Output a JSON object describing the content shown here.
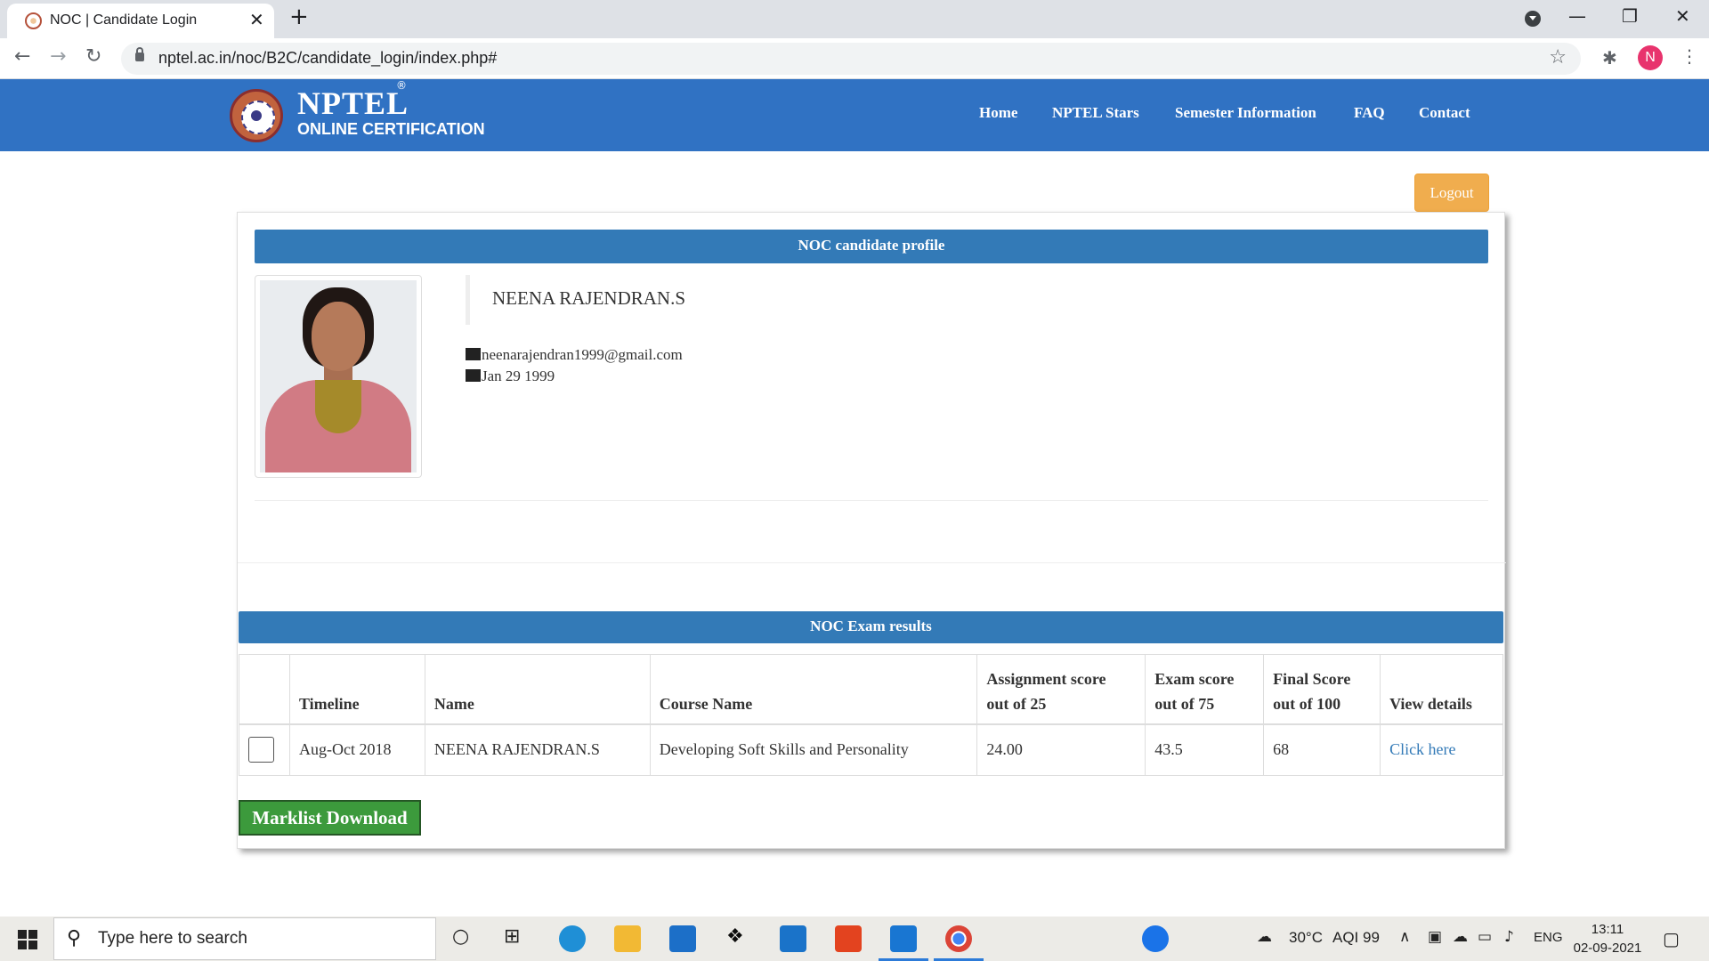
{
  "browser": {
    "tab_title": "NOC | Candidate Login",
    "tab_close": "✕",
    "new_tab": "+",
    "url": "nptel.ac.in/noc/B2C/candidate_login/index.php#",
    "profile_initial": "N",
    "window_controls": [
      "—",
      "❐",
      "✕"
    ]
  },
  "site": {
    "logo_title": "NPTEL",
    "logo_reg": "®",
    "logo_subtitle": "ONLINE CERTIFICATION",
    "nav": [
      "Home",
      "NPTEL Stars",
      "Semester Information",
      "FAQ",
      "Contact"
    ],
    "logout": "Logout"
  },
  "profile": {
    "heading": "NOC candidate profile",
    "name": "NEENA RAJENDRAN.S",
    "email": "neenarajendran1999@gmail.com",
    "dob": "Jan 29 1999"
  },
  "results": {
    "heading": "NOC Exam results",
    "columns": [
      [
        "Timeline"
      ],
      [
        "Name"
      ],
      [
        "Course Name"
      ],
      [
        "Assignment score",
        "out of 25"
      ],
      [
        "Exam score",
        "out of 75"
      ],
      [
        "Final Score",
        "out of 100"
      ],
      [
        "View details"
      ]
    ],
    "rows": [
      {
        "timeline": "Aug-Oct 2018",
        "name": "NEENA RAJENDRAN.S",
        "course": "Developing Soft Skills and Personality",
        "assignment": "24.00",
        "exam": "43.5",
        "final": "68",
        "details": "Click here"
      }
    ],
    "download": "Marklist Download"
  },
  "taskbar": {
    "search_placeholder": "Type here to search",
    "weather": "30°C",
    "aqi": "AQI 99",
    "lang": "ENG",
    "time": "13:11",
    "date": "02-09-2021"
  },
  "icons": [
    "back-arrow-icon",
    "forward-arrow-icon",
    "reload-icon",
    "lock-icon",
    "star-icon",
    "extensions-icon",
    "kebab-menu-icon",
    "envelope-icon",
    "gift-icon",
    "windows-start-icon",
    "search-icon"
  ]
}
